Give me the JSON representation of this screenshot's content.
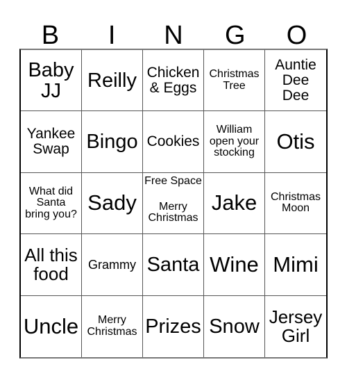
{
  "card": {
    "headers": [
      "B",
      "I",
      "N",
      "G",
      "O"
    ],
    "free_space_label": "Free Space",
    "cells": [
      {
        "text": "Baby\nJJ",
        "size": "xl",
        "free": false
      },
      {
        "text": "Reilly",
        "size": "xl",
        "free": false
      },
      {
        "text": "Chicken\n& Eggs",
        "size": "md",
        "free": false
      },
      {
        "text": "Christmas\nTree",
        "size": "xs",
        "free": false
      },
      {
        "text": "Auntie\nDee\nDee",
        "size": "md",
        "free": false
      },
      {
        "text": "Yankee\nSwap",
        "size": "md",
        "free": false
      },
      {
        "text": "Bingo",
        "size": "xl",
        "free": false
      },
      {
        "text": "Cookies",
        "size": "md",
        "free": false
      },
      {
        "text": "William\nopen your\nstocking",
        "size": "xs",
        "free": false
      },
      {
        "text": "Otis",
        "size": "xxl",
        "free": false
      },
      {
        "text": "What did\nSanta\nbring you?",
        "size": "xs",
        "free": false
      },
      {
        "text": "Sady",
        "size": "xxl",
        "free": false
      },
      {
        "text": "Merry\nChristmas",
        "size": "xs",
        "free": true
      },
      {
        "text": "Jake",
        "size": "xxl",
        "free": false
      },
      {
        "text": "Christmas\nMoon",
        "size": "xs",
        "free": false
      },
      {
        "text": "All this\nfood",
        "size": "lg",
        "free": false
      },
      {
        "text": "Grammy",
        "size": "sm",
        "free": false
      },
      {
        "text": "Santa",
        "size": "xl",
        "free": false
      },
      {
        "text": "Wine",
        "size": "xxl",
        "free": false
      },
      {
        "text": "Mimi",
        "size": "xxl",
        "free": false
      },
      {
        "text": "Uncle",
        "size": "xxl",
        "free": false
      },
      {
        "text": "Merry\nChristmas",
        "size": "xs",
        "free": false
      },
      {
        "text": "Prizes",
        "size": "xl",
        "free": false
      },
      {
        "text": "Snow",
        "size": "xl",
        "free": false
      },
      {
        "text": "Jersey\nGirl",
        "size": "lg",
        "free": false
      }
    ]
  }
}
